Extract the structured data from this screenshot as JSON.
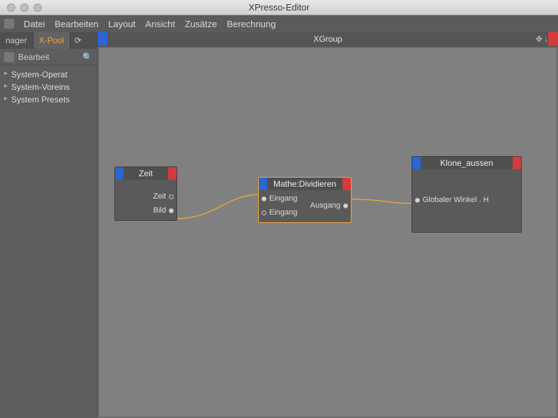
{
  "window": {
    "title": "XPresso-Editor"
  },
  "menubar": [
    "Datei",
    "Bearbeiten",
    "Layout",
    "Ansicht",
    "Zusätze",
    "Berechnung"
  ],
  "sidebar": {
    "tabs": [
      {
        "label": "nager",
        "active": false
      },
      {
        "label": "X-Pool",
        "active": true
      }
    ],
    "toolbar_label": "Bearbeit",
    "tree": [
      "System-Operat",
      "System-Voreins",
      "System Presets"
    ]
  },
  "canvas": {
    "title": "XGroup"
  },
  "nodes": {
    "zeit": {
      "title": "Zeit",
      "outputs": [
        {
          "label": "Zeit",
          "filled": false
        },
        {
          "label": "Bild",
          "filled": true
        }
      ]
    },
    "mathe": {
      "title": "Mathe:Dividieren",
      "inputs": [
        {
          "label": "Eingang",
          "filled": true
        },
        {
          "label": "Eingang",
          "filled": false
        }
      ],
      "outputs": [
        {
          "label": "Ausgang",
          "filled": true
        }
      ]
    },
    "klone": {
      "title": "Klone_aussen",
      "inputs": [
        {
          "label": "Globaler Winkel . H",
          "filled": true
        }
      ]
    }
  }
}
